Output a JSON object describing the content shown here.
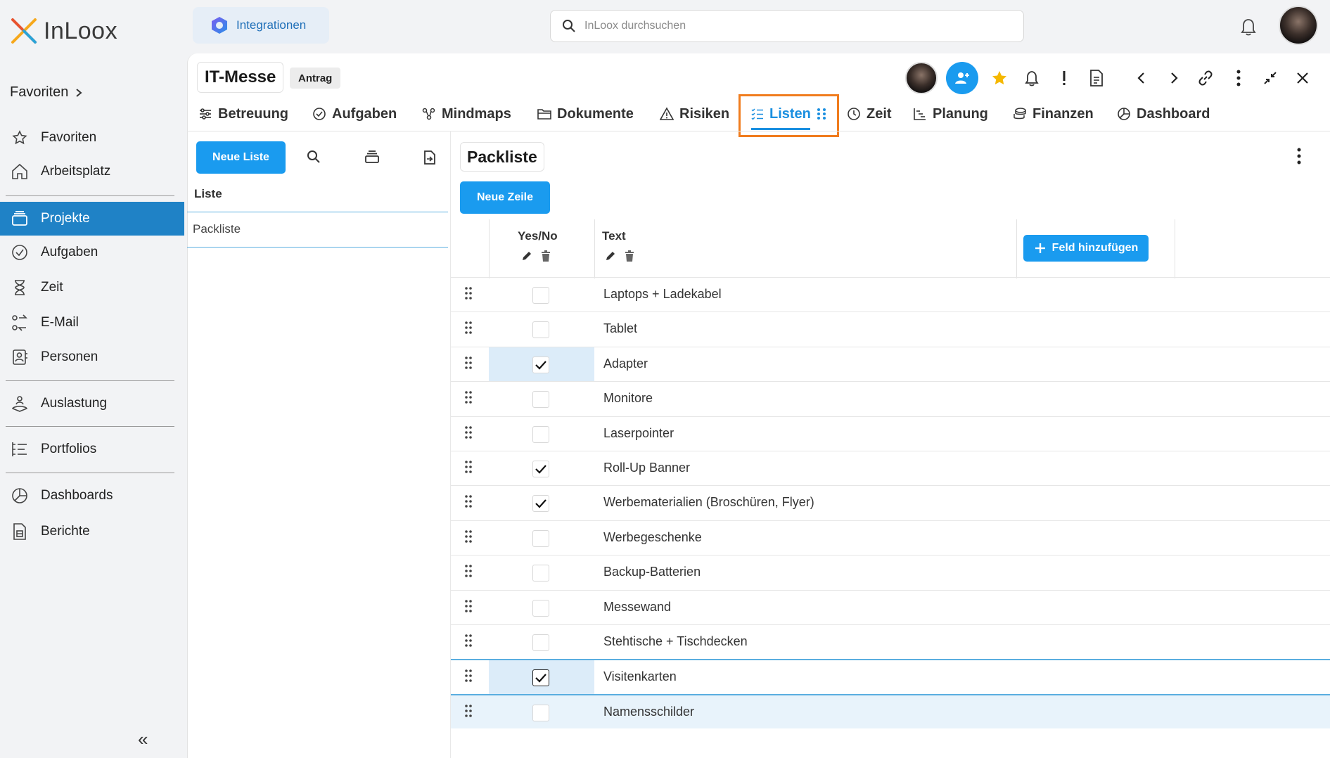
{
  "app": {
    "name": "InLoox"
  },
  "sidebar": {
    "favorites_header": "Favoriten",
    "items": [
      {
        "label": "Favoriten",
        "icon": "star-icon"
      },
      {
        "label": "Arbeitsplatz",
        "icon": "home-icon"
      },
      {
        "label": "Projekte",
        "icon": "projects-icon",
        "active": true
      },
      {
        "label": "Aufgaben",
        "icon": "check-circle-icon"
      },
      {
        "label": "Zeit",
        "icon": "hourglass-icon"
      },
      {
        "label": "E-Mail",
        "icon": "email-icon"
      },
      {
        "label": "Personen",
        "icon": "contacts-icon"
      },
      {
        "label": "Auslastung",
        "icon": "workload-icon"
      },
      {
        "label": "Portfolios",
        "icon": "portfolio-icon"
      },
      {
        "label": "Dashboards",
        "icon": "pie-chart-icon"
      },
      {
        "label": "Berichte",
        "icon": "report-icon"
      }
    ],
    "collapse_glyph": "«"
  },
  "topbar": {
    "integrations_label": "Integrationen",
    "search_placeholder": "InLoox durchsuchen"
  },
  "project": {
    "title": "IT-Messe",
    "status_badge": "Antrag"
  },
  "tabs": [
    {
      "label": "Betreuung",
      "icon": "sliders-icon"
    },
    {
      "label": "Aufgaben",
      "icon": "check-circle-icon"
    },
    {
      "label": "Mindmaps",
      "icon": "mindmap-icon"
    },
    {
      "label": "Dokumente",
      "icon": "folder-icon"
    },
    {
      "label": "Risiken",
      "icon": "warning-icon"
    },
    {
      "label": "Listen",
      "icon": "list-icon",
      "active": true
    },
    {
      "label": "Zeit",
      "icon": "clock-icon"
    },
    {
      "label": "Planung",
      "icon": "gantt-icon"
    },
    {
      "label": "Finanzen",
      "icon": "coins-icon"
    },
    {
      "label": "Dashboard",
      "icon": "pie-chart-icon"
    }
  ],
  "lists_panel": {
    "new_list_label": "Neue Liste",
    "column_header": "Liste",
    "items": [
      "Packliste"
    ]
  },
  "list_detail": {
    "title": "Packliste",
    "new_row_label": "Neue Zeile",
    "columns": [
      "Yes/No",
      "Text"
    ],
    "add_field_label": "Feld hinzufügen",
    "rows": [
      {
        "checked": false,
        "text": "Laptops + Ladekabel"
      },
      {
        "checked": false,
        "text": "Tablet"
      },
      {
        "checked": true,
        "text": "Adapter"
      },
      {
        "checked": false,
        "text": "Monitore"
      },
      {
        "checked": false,
        "text": "Laserpointer"
      },
      {
        "checked": true,
        "text": "Roll-Up Banner"
      },
      {
        "checked": true,
        "text": "Werbematerialien (Broschüren, Flyer)"
      },
      {
        "checked": false,
        "text": "Werbegeschenke"
      },
      {
        "checked": false,
        "text": "Backup-Batterien"
      },
      {
        "checked": false,
        "text": "Messewand"
      },
      {
        "checked": false,
        "text": "Stehtische + Tischdecken"
      },
      {
        "checked": true,
        "text": "Visitenkarten"
      },
      {
        "checked": false,
        "text": "Namensschilder"
      }
    ]
  },
  "colors": {
    "accent": "#1a9bef",
    "active_nav": "#1f82c6",
    "tab_highlight": "#f07c1e",
    "row_highlight": "#e8f3fb"
  }
}
